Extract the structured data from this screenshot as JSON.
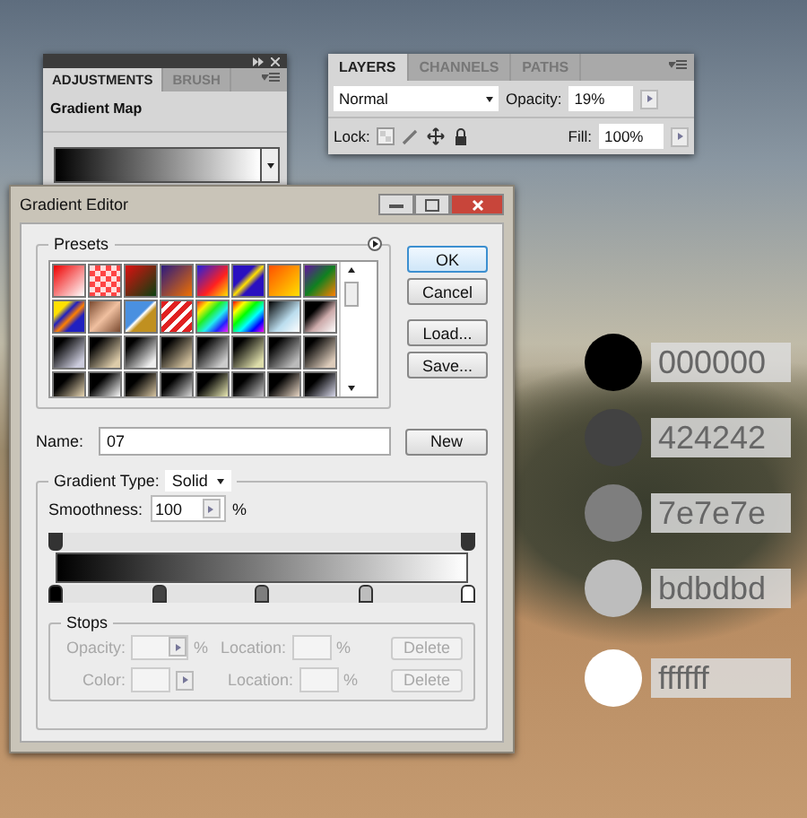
{
  "adjustments_panel": {
    "tabs": [
      {
        "label": "ADJUSTMENTS",
        "selected": true
      },
      {
        "label": "BRUSH",
        "selected": false
      }
    ],
    "title": "Gradient Map"
  },
  "layers_panel": {
    "tabs": [
      {
        "label": "LAYERS",
        "selected": true
      },
      {
        "label": "CHANNELS",
        "selected": false
      },
      {
        "label": "PATHS",
        "selected": false
      }
    ],
    "blend_mode": "Normal",
    "opacity_label": "Opacity:",
    "opacity": "19%",
    "lock_label": "Lock:",
    "fill_label": "Fill:",
    "fill": "100%"
  },
  "gradient_editor": {
    "title": "Gradient Editor",
    "presets_label": "Presets",
    "buttons": [
      {
        "label": "OK",
        "default": true
      },
      {
        "label": "Cancel",
        "default": false
      },
      {
        "label": "Load...",
        "default": false
      },
      {
        "label": "Save...",
        "default": false
      }
    ],
    "name_label": "Name:",
    "name": "07",
    "new_button": "New",
    "gradient_type_label": "Gradient Type:",
    "gradient_type": "Solid",
    "smoothness_label": "Smoothness:",
    "smoothness": "100",
    "smoothness_unit": "%",
    "opacity_stops": [
      {
        "level": 0
      },
      {
        "level": 1
      }
    ],
    "color_stops": [
      {
        "level": 0,
        "color": "#000000"
      },
      {
        "level": 0.25,
        "color": "#424242"
      },
      {
        "level": 0.5,
        "color": "#7e7e7e"
      },
      {
        "level": 0.75,
        "color": "#bdbdbd"
      },
      {
        "level": 1,
        "color": "#ffffff"
      }
    ],
    "stops": {
      "label": "Stops",
      "disabled": true,
      "rows": [
        {
          "kind": "opacity",
          "field_label": "Opacity:",
          "unit": "%",
          "location_label": "Location:",
          "location_unit": "%",
          "button": "Delete"
        },
        {
          "kind": "color",
          "field_label": "Color:",
          "location_label": "Location:",
          "location_unit": "%",
          "button": "Delete"
        }
      ]
    }
  },
  "swatches": [
    {
      "color": "#000000",
      "label": "000000"
    },
    {
      "color": "#424242",
      "label": "424242"
    },
    {
      "color": "#7e7e7e",
      "label": "7e7e7e"
    },
    {
      "color": "#bdbdbd",
      "label": "bdbdbd"
    },
    {
      "color": "#ffffff",
      "label": "ffffff"
    }
  ]
}
